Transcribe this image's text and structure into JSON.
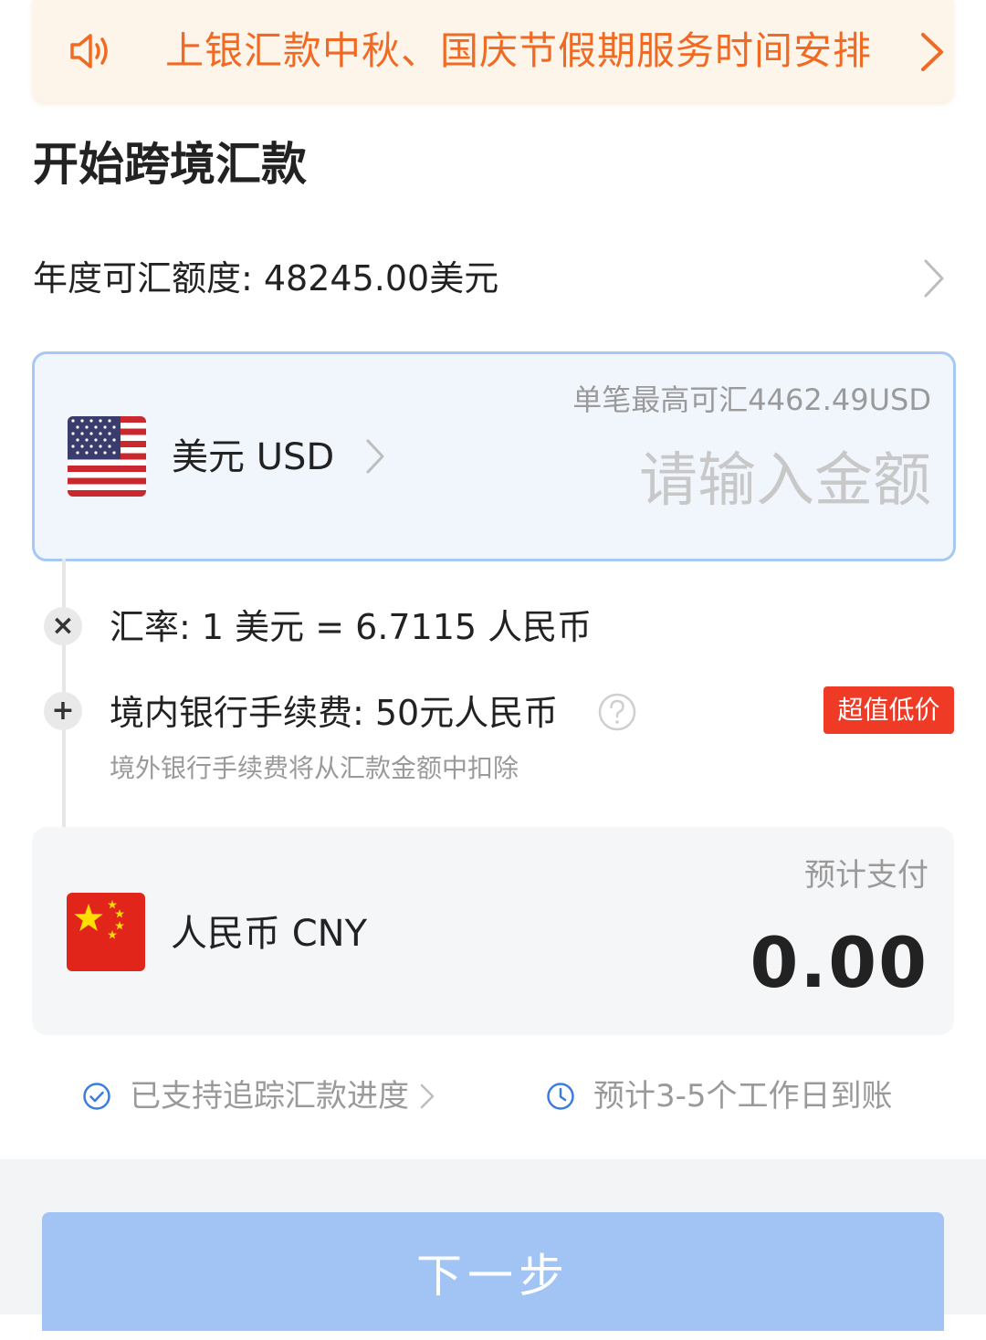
{
  "notice": {
    "text": "上银汇款中秋、国庆节假期服务时间安排",
    "icon": "speaker-icon",
    "color": "#f06a24"
  },
  "page_title": "开始跨境汇款",
  "quota": {
    "label": "年度可汇额度: 48245.00美元"
  },
  "send": {
    "currency": "美元 USD",
    "limit": "单笔最高可汇4462.49USD",
    "amount_placeholder": "请输入金额"
  },
  "rate": {
    "text": "汇率: 1 美元 = 6.7115 人民币"
  },
  "fee": {
    "text": "境内银行手续费: 50元人民币",
    "badge": "超值低价",
    "note": "境外银行手续费将从汇款金额中扣除"
  },
  "receive": {
    "currency": "人民币 CNY",
    "pay_label": "预计支付",
    "pay_amount": "0.00"
  },
  "info": {
    "tracking": "已支持追踪汇款进度",
    "arrival": "预计3-5个工作日到账"
  },
  "next_button": "下一步",
  "colors": {
    "accent_blue": "#a2c4f4",
    "badge_red": "#ef3b26",
    "icon_blue": "#3a7de0"
  }
}
